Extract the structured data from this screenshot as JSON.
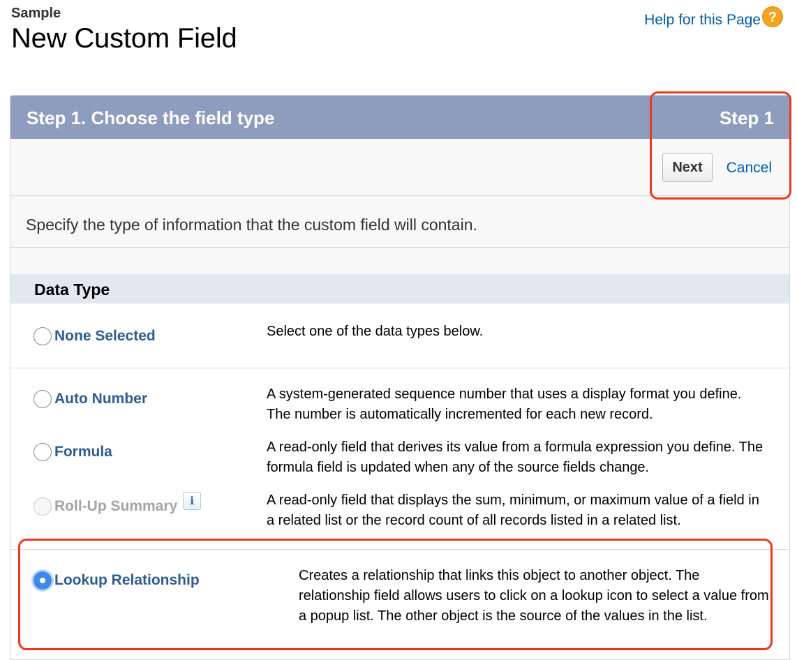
{
  "header": {
    "object_name": "Sample",
    "title": "New Custom Field",
    "help_label": "Help for this Page",
    "help_icon": "?"
  },
  "step": {
    "title": "Step 1. Choose the field type",
    "indicator": "Step 1",
    "next_label": "Next",
    "cancel_label": "Cancel"
  },
  "intro": "Specify the type of information that the custom field will contain.",
  "data_type": {
    "section_title": "Data Type",
    "info_icon": "i",
    "options": [
      {
        "label": "None Selected",
        "description": "Select one of the data types below.",
        "state": "unselected"
      },
      {
        "label": "Auto Number",
        "description": "A system-generated sequence number that uses a display format you define. The number is automatically incremented for each new record.",
        "state": "unselected"
      },
      {
        "label": "Formula",
        "description": "A read-only field that derives its value from a formula expression you define. The formula field is updated when any of the source fields change.",
        "state": "unselected"
      },
      {
        "label": "Roll-Up Summary",
        "description": "A read-only field that displays the sum, minimum, or maximum value of a field in a related list or the record count of all records listed in a related list.",
        "state": "disabled"
      },
      {
        "label": "Lookup Relationship",
        "description": "Creates a relationship that links this object to another object. The relationship field allows users to click on a lookup icon to select a value from a popup list. The other object is the source of the values in the list.",
        "state": "selected"
      }
    ]
  },
  "colors": {
    "header_bar": "#8e9dbe",
    "link": "#015ba7",
    "selected_radio": "#3d8ae8",
    "callout": "#e8391f"
  }
}
